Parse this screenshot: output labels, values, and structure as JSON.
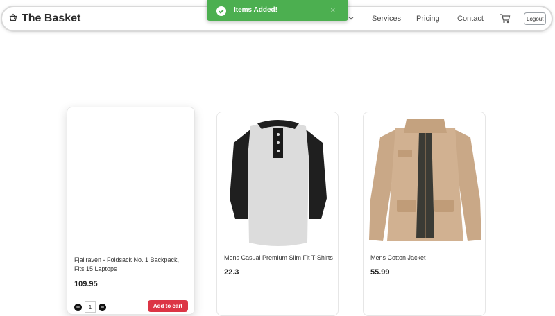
{
  "brand": {
    "title": "The Basket",
    "icon": "basket-icon"
  },
  "nav": {
    "items": [
      {
        "label": "Services"
      },
      {
        "label": "Pricing"
      },
      {
        "label": "Contact"
      }
    ],
    "logout_label": "Logout"
  },
  "toast": {
    "message": "Items Added!",
    "close_symbol": "×",
    "color": "#4caf50"
  },
  "products": [
    {
      "title_line1": "Fjallraven - Foldsack No. 1 Backpack,",
      "title_line2": "Fits 15 Laptops",
      "price": "109.95",
      "quantity": "1",
      "add_label": "Add to cart",
      "increment_symbol": "+",
      "decrement_symbol": "−"
    },
    {
      "title_line1": "Mens Casual Premium Slim Fit T-Shirts",
      "price": "22.3"
    },
    {
      "title_line1": "Mens Cotton Jacket",
      "price": "55.99"
    }
  ],
  "colors": {
    "accent_red": "#dc3545",
    "toast_green": "#4caf50"
  }
}
